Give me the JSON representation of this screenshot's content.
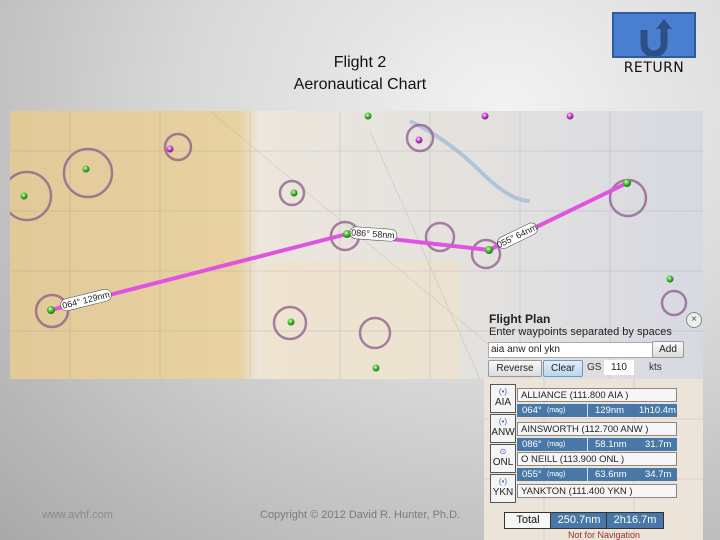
{
  "header": {
    "title_line1": "Flight 2",
    "title_line2": "Aeronautical Chart",
    "return_label": "RETURN"
  },
  "footer": {
    "website": "www.avhf.com",
    "copyright": "Copyright © 2012 David R. Hunter, Ph.D."
  },
  "map": {
    "route_color": "#e052e0",
    "leg_labels": [
      "064° 129nm",
      "086° 58nm",
      "055° 64nm"
    ]
  },
  "flight_plan": {
    "title": "Flight Plan",
    "subtitle": "Enter waypoints separated by spaces",
    "close_icon": "×",
    "waypoints_input": "aia anw onl ykn",
    "add_label": "Add",
    "reverse_label": "Reverse",
    "clear_label": "Clear",
    "gs_label": "GS",
    "gs_value": "110",
    "kts_label": "kts",
    "waypoints": [
      {
        "code": "AIA",
        "glyph": "(•)",
        "name": "ALLIANCE (111.800 AIA )"
      },
      {
        "code": "ANW",
        "glyph": "(•)",
        "name": "AINSWORTH (112.700 ANW )"
      },
      {
        "code": "ONL",
        "glyph": "⊙",
        "name": "O NEILL (113.900 ONL )"
      },
      {
        "code": "YKN",
        "glyph": "(•)",
        "name": "YANKTON (111.400 YKN )"
      }
    ],
    "legs": [
      {
        "course": "064°",
        "course_note": "(mag)",
        "distance": "129nm",
        "time": "1h10.4m"
      },
      {
        "course": "086°",
        "course_note": "(mag)",
        "distance": "58.1nm",
        "time": "31.7m"
      },
      {
        "course": "055°",
        "course_note": "(mag)",
        "distance": "63.6nm",
        "time": "34.7m"
      }
    ],
    "total_label": "Total",
    "total_distance": "250.7nm",
    "total_time": "2h16.7m",
    "disclaimer": "Not for Navigation"
  }
}
